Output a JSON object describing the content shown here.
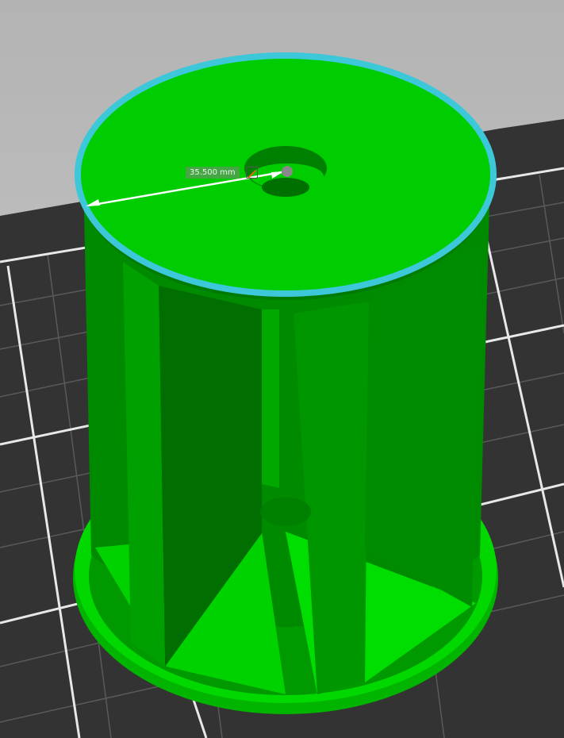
{
  "measurement": {
    "value_label": "35.500 mm",
    "edit_icon": "pencil-icon"
  },
  "colors": {
    "model": "#00c800",
    "selected_edge": "#3cc8d8",
    "plate": "#333333",
    "background": "#c4c4c4"
  }
}
